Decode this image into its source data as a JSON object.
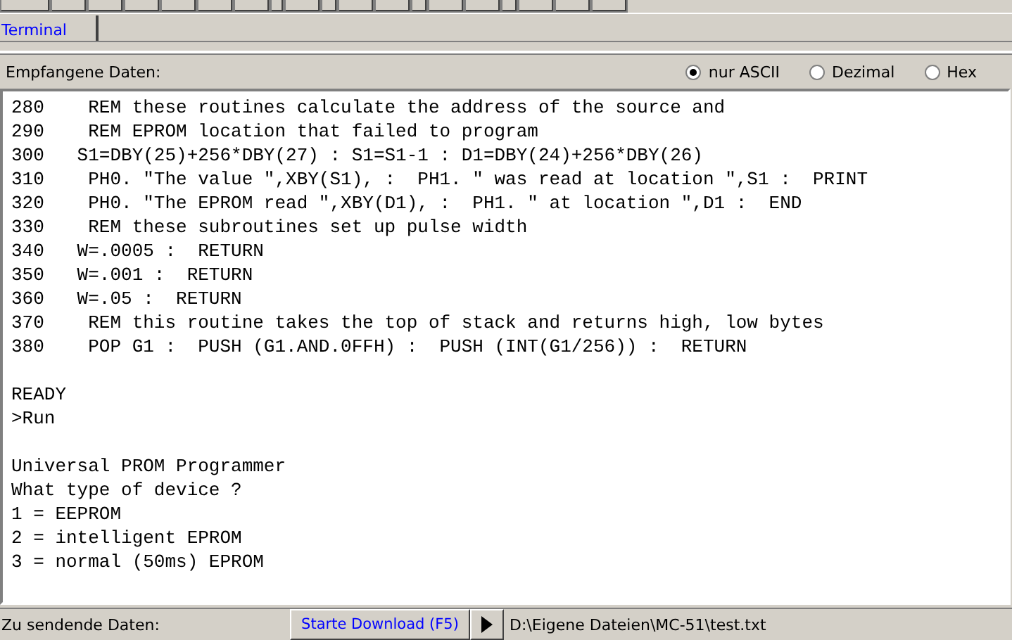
{
  "tabs": [
    {
      "label": "Terminal",
      "selected": true
    }
  ],
  "received": {
    "label": "Empfangene Daten:",
    "modes": [
      {
        "label": "nur ASCII",
        "selected": true
      },
      {
        "label": "Dezimal",
        "selected": false
      },
      {
        "label": "Hex",
        "selected": false
      }
    ]
  },
  "terminal_blocks": [
    [
      "280    REM these routines calculate the address of the source and",
      "290    REM EPROM location that failed to program",
      "300   S1=DBY(25)+256*DBY(27) : S1=S1-1 : D1=DBY(24)+256*DBY(26)",
      "310    PH0. \"The value \",XBY(S1), :  PH1. \" was read at location \",S1 :  PRINT",
      "320    PH0. \"The EPROM read \",XBY(D1), :  PH1. \" at location \",D1 :  END",
      "330    REM these subroutines set up pulse width",
      "340   W=.0005 :  RETURN",
      "350   W=.001 :  RETURN",
      "360   W=.05 :  RETURN",
      "370    REM this routine takes the top of stack and returns high, low bytes",
      "380    POP G1 :  PUSH (G1.AND.0FFH) :  PUSH (INT(G1/256)) :  RETURN"
    ],
    [
      "READY",
      ">Run"
    ],
    [
      "Universal PROM Programmer",
      "What type of device ?",
      "1 = EEPROM",
      "2 = intelligent EPROM",
      "3 = normal (50ms) EPROM"
    ]
  ],
  "send": {
    "label": "Zu sendende Daten:",
    "button": "Starte Download (F5)",
    "file_path": "D:\\Eigene Dateien\\MC-51\\test.txt"
  }
}
